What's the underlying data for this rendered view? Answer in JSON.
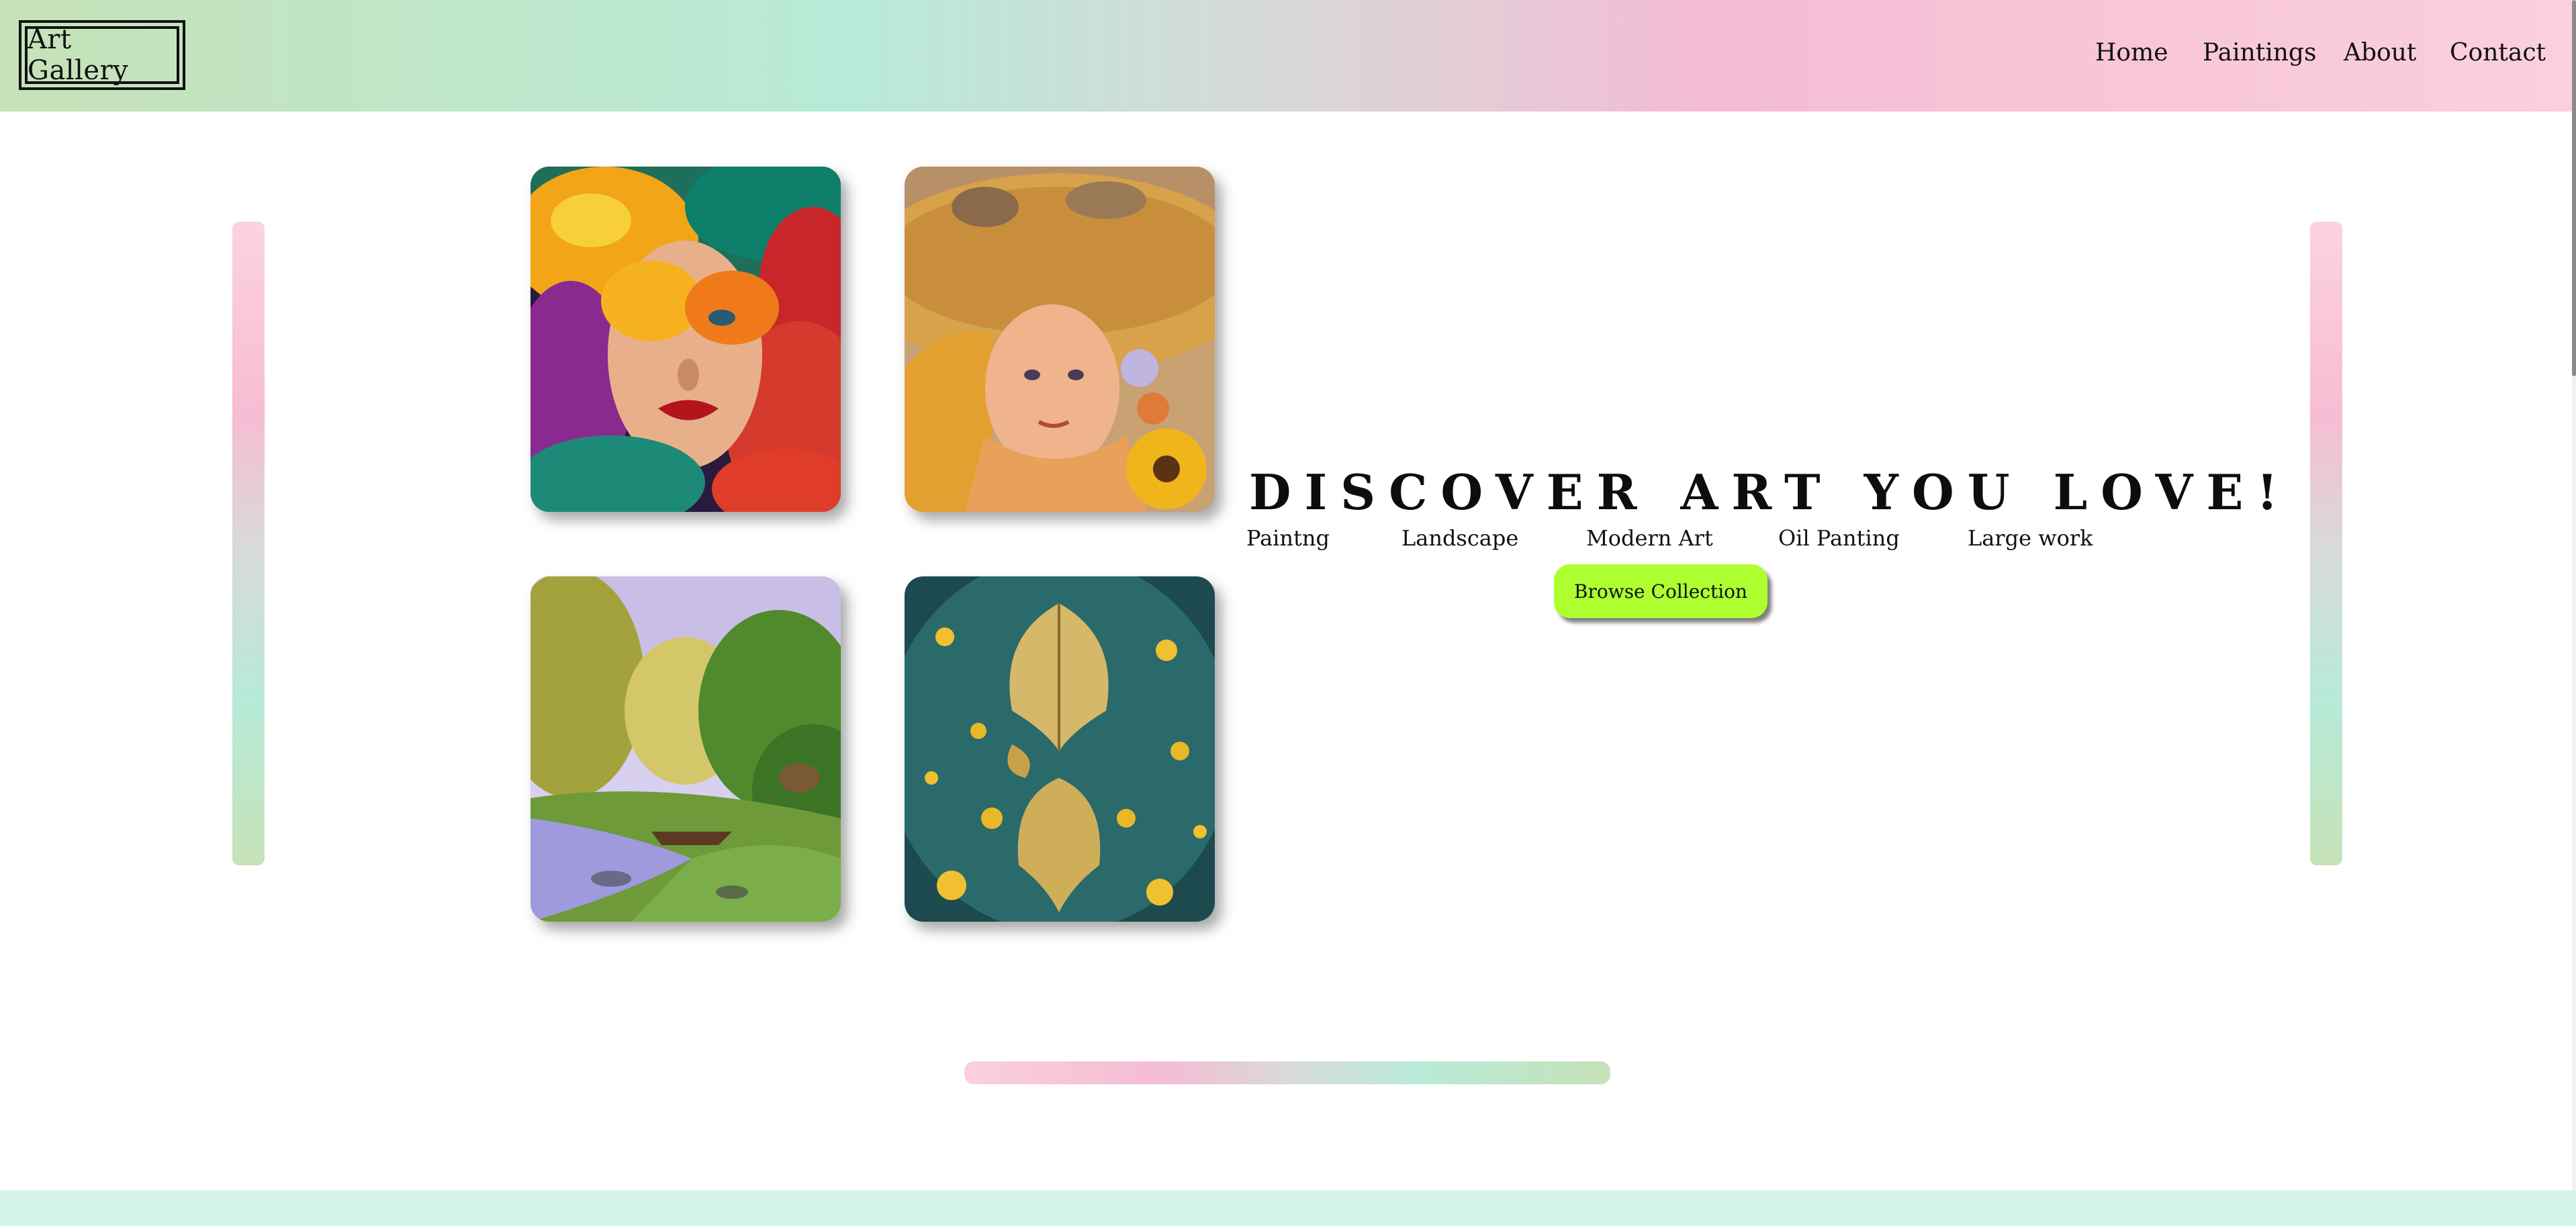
{
  "header": {
    "logo_text": "Art Gallery",
    "nav": [
      {
        "label": "Home"
      },
      {
        "label": "Paintings"
      },
      {
        "label": "About"
      },
      {
        "label": "Contact"
      }
    ]
  },
  "hero": {
    "title": "DISCOVER ART YOU LOVE!",
    "categories": [
      "Paintng",
      "Landscape",
      "Modern Art",
      "Oil Panting",
      "Large work"
    ],
    "cta_label": "Browse Collection"
  },
  "gallery": [
    {
      "subject": "woman face with colorful flowers and leaves"
    },
    {
      "subject": "girl in a straw hat with sunflowers"
    },
    {
      "subject": "river landscape with trees and a boat"
    },
    {
      "subject": "golden leaves floating on teal background"
    }
  ],
  "colors": {
    "accent": "#adff2f",
    "mint": "#b8ead8",
    "pink": "#f4bcd4",
    "sage": "#c6e2b8"
  }
}
